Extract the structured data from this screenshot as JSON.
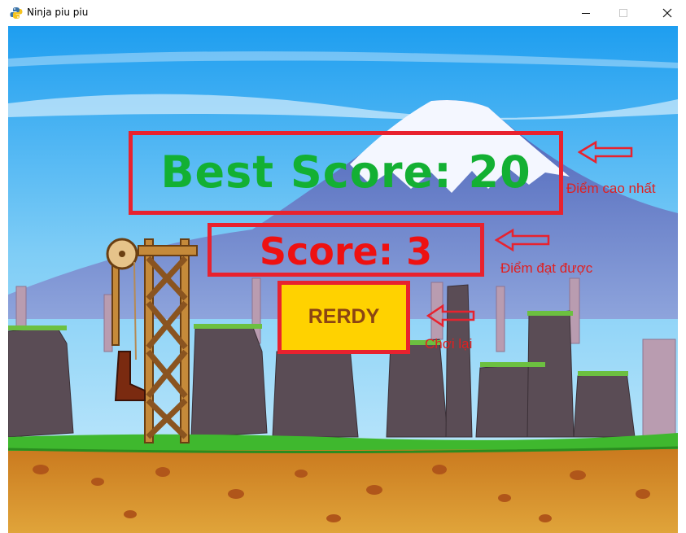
{
  "window": {
    "title": "Ninja piu piu",
    "icon": "python-icon",
    "controls": [
      "minimize-icon",
      "maximize-icon",
      "close-icon"
    ]
  },
  "game": {
    "best_score": "Best Score: 20",
    "score": "Score: 3",
    "ready_button": "RERDY"
  },
  "annotations": {
    "best": "Điểm cao nhất",
    "score": "Điểm đạt được",
    "replay": "Chơi lại"
  },
  "colors": {
    "annotation_red": "#e8222e",
    "best_green": "#13b033",
    "score_red": "#ee1111",
    "button_yellow": "#ffd200",
    "button_text": "#8b4513"
  }
}
